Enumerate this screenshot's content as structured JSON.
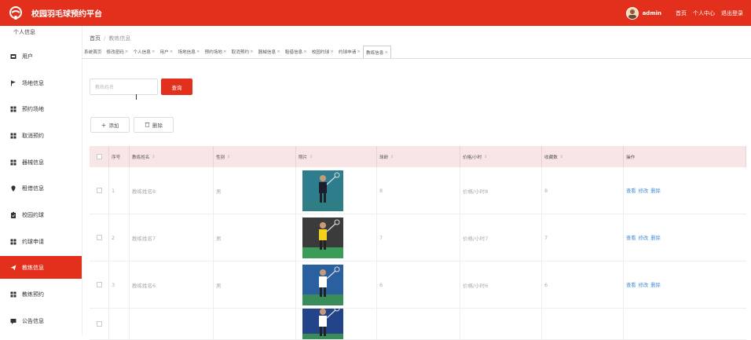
{
  "header": {
    "title": "校园羽毛球预约平台",
    "username": "admin",
    "links": [
      "首页",
      "个人中心",
      "退出登录"
    ]
  },
  "sidebar": {
    "header": "个人信息",
    "items": [
      {
        "label": "用户",
        "icon": "user-icon"
      },
      {
        "label": "场地信息",
        "icon": "flag-icon"
      },
      {
        "label": "预约场地",
        "icon": "grid-icon"
      },
      {
        "label": "取消预约",
        "icon": "grid-icon"
      },
      {
        "label": "器械信息",
        "icon": "grid-icon"
      },
      {
        "label": "租借信息",
        "icon": "pin-icon"
      },
      {
        "label": "校园约球",
        "icon": "clipboard-icon"
      },
      {
        "label": "约球申请",
        "icon": "grid-icon"
      },
      {
        "label": "教练信息",
        "icon": "plane-icon",
        "active": true
      },
      {
        "label": "教练预约",
        "icon": "grid-icon"
      },
      {
        "label": "公告信息",
        "icon": "message-icon"
      }
    ]
  },
  "breadcrumb": {
    "home": "首页",
    "separator": "/",
    "current": "教练信息"
  },
  "tabs": [
    "系统首页",
    "修改密码",
    "个人信息",
    "用户",
    "场地信息",
    "预约场地",
    "取消预约",
    "器械信息",
    "租借信息",
    "校园约球",
    "约球申请",
    "教练信息"
  ],
  "active_tab": "教练信息",
  "search": {
    "placeholder": "教练姓名",
    "button": "查询"
  },
  "actions": {
    "add": "添加",
    "delete": "删除"
  },
  "table": {
    "columns": [
      "序号",
      "教练姓名",
      "性别",
      "照片",
      "球龄",
      "价格/小时",
      "收藏数",
      "操作"
    ],
    "rows": [
      {
        "index": "1",
        "name": "教练姓名8",
        "gender": "男",
        "age": "8",
        "price": "价格/小时8",
        "favorites": "8"
      },
      {
        "index": "2",
        "name": "教练姓名7",
        "gender": "男",
        "age": "7",
        "price": "价格/小时7",
        "favorites": "7"
      },
      {
        "index": "3",
        "name": "教练姓名6",
        "gender": "男",
        "age": "6",
        "price": "价格/小时6",
        "favorites": "6"
      },
      {
        "index": "",
        "name": "",
        "gender": "",
        "age": "",
        "price": "",
        "favorites": ""
      }
    ],
    "ops": [
      "查看",
      "修改",
      "删除"
    ]
  },
  "colors": {
    "brand": "#e3301c",
    "header_row": "#f8e6e6",
    "link": "#4a8fd6"
  }
}
